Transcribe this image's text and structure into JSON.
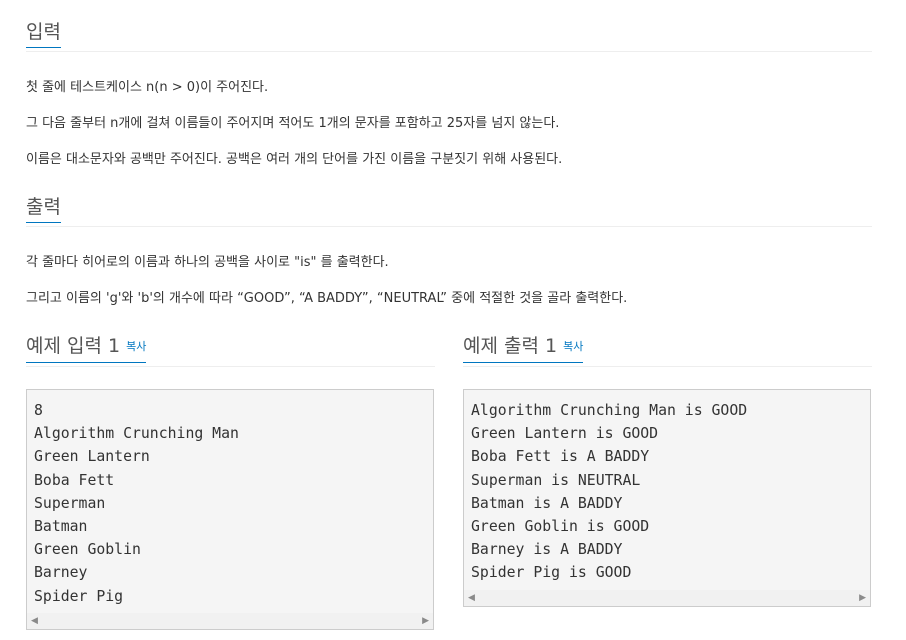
{
  "input": {
    "title": "입력",
    "lines": [
      "첫 줄에 테스트케이스 n(n > 0)이 주어진다.",
      "그 다음 줄부터 n개에 걸쳐 이름들이 주어지며 적어도 1개의 문자를 포함하고 25자를 넘지 않는다.",
      "이름은 대소문자와 공백만 주어진다. 공백은 여러 개의 단어를 가진 이름을 구분짓기 위해 사용된다."
    ]
  },
  "output": {
    "title": "출력",
    "lines": [
      "각 줄마다 히어로의 이름과 하나의 공백을 사이로 \"is\" 를 출력한다.",
      "그리고 이름의 'g'와 'b'의 개수에 따라 “GOOD”, “A BADDY”, “NEUTRAL”  중에 적절한 것을 골라 출력한다."
    ]
  },
  "sample_input": {
    "title": "예제 입력 1",
    "copy_label": "복사",
    "content": "8\nAlgorithm Crunching Man\nGreen Lantern\nBoba Fett\nSuperman\nBatman\nGreen Goblin\nBarney\nSpider Pig"
  },
  "sample_output": {
    "title": "예제 출력 1",
    "copy_label": "복사",
    "content": "Algorithm Crunching Man is GOOD\nGreen Lantern is GOOD\nBoba Fett is A BADDY\nSuperman is NEUTRAL\nBatman is A BADDY\nGreen Goblin is GOOD\nBarney is A BADDY\nSpider Pig is GOOD"
  },
  "scrollbar": {
    "left_arrow": "◀",
    "right_arrow": "▶"
  },
  "colors": {
    "accent": "#0076c0",
    "text": "#333333",
    "code_bg": "#f5f5f5"
  }
}
